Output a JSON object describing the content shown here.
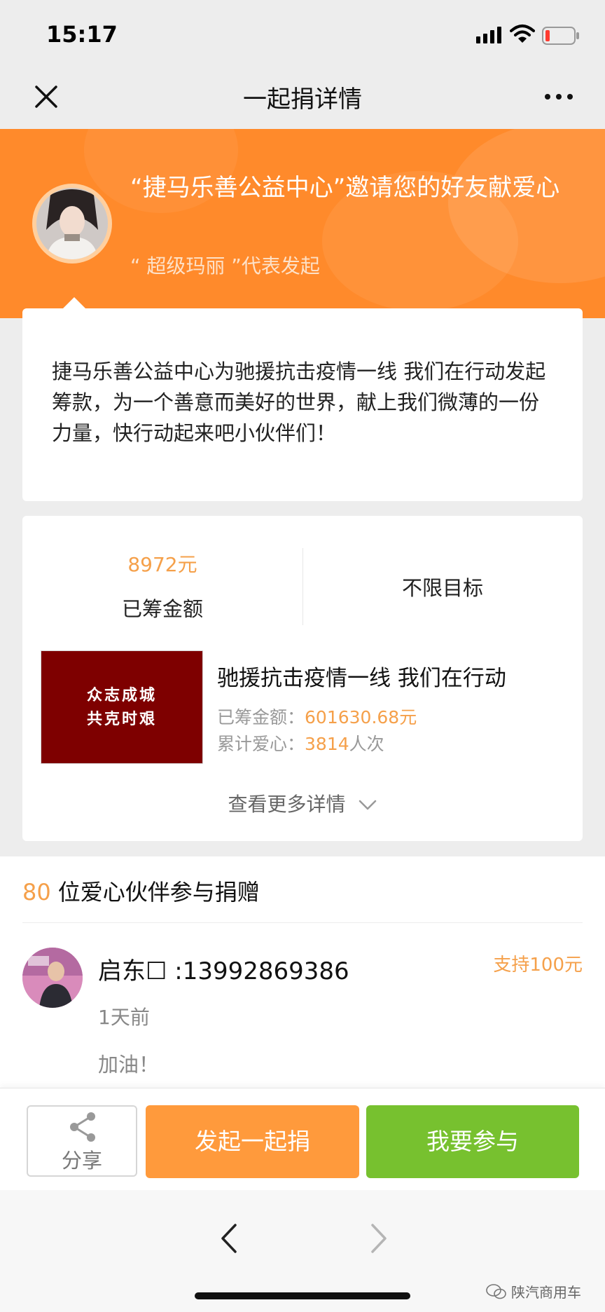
{
  "status_bar": {
    "time": "15:17"
  },
  "nav": {
    "title": "一起捐详情"
  },
  "hero": {
    "title": "“捷马乐善公益中心”邀请您的好友献爱心",
    "subtitle": "“ 超级玛丽 ”代表发起"
  },
  "description": {
    "text": "捷马乐善公益中心为驰援抗击疫情一线 我们在行动发起筹款，为一个善意而美好的世界，献上我们微薄的一份力量，快行动起来吧小伙伴们！"
  },
  "stats": {
    "raised_amount": "8972元",
    "raised_label": "已筹金额",
    "target_label": "不限目标"
  },
  "project": {
    "banner_lines": [
      "众志成城",
      "共克时艰"
    ],
    "title": "驰援抗击疫情一线 我们在行动",
    "raised_label": "已筹金额：",
    "raised_value": "601630.68",
    "raised_unit": "元",
    "love_label": "累计爱心：",
    "love_value": "3814",
    "love_unit": "人次",
    "more_details": "查看更多详情"
  },
  "donors": {
    "count": "80",
    "count_label": "位爱心伙伴参与捐赠",
    "items": [
      {
        "name": "启东☐ :13992869386",
        "amount": "支持100元",
        "time": "1天前",
        "message": "加油！"
      }
    ]
  },
  "actions": {
    "share_label": "分享",
    "start_label": "发起一起捐",
    "join_label": "我要参与"
  },
  "watermark": {
    "text": "陕汽商用车"
  },
  "colors": {
    "hero": "#ff8a2b",
    "accent": "#f5a04a",
    "start_button": "#ff9a3c",
    "join_button": "#77c12f",
    "banner": "#7e0000"
  }
}
